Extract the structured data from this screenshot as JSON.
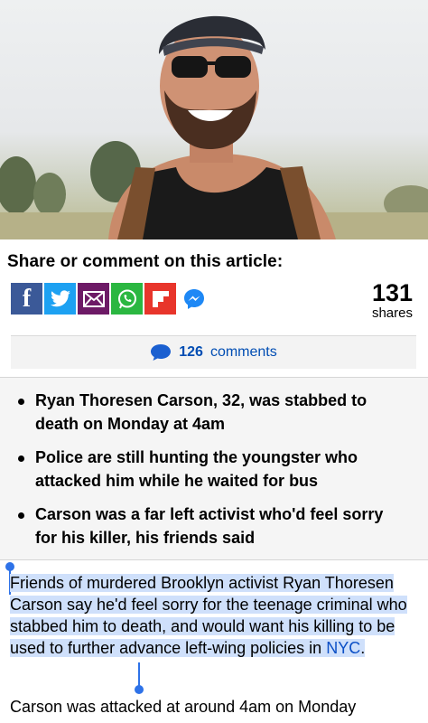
{
  "share": {
    "title": "Share or comment on this article:",
    "icons": [
      "facebook-icon",
      "twitter-icon",
      "email-icon",
      "whatsapp-icon",
      "flipboard-icon",
      "messenger-icon"
    ],
    "count": "131",
    "count_label": "shares"
  },
  "comments": {
    "count": "126",
    "label": "comments"
  },
  "bullets": [
    "Ryan Thoresen Carson, 32, was stabbed to death on Monday at 4am",
    "Police are still hunting the youngster who attacked him while he waited for bus",
    "Carson was a far left activist who'd feel sorry for his killer, his friends said"
  ],
  "article": {
    "para1_text": "Friends of murdered Brooklyn activist Ryan Thoresen Carson say he'd feel sorry for the teenage criminal who stabbed him to death, and would want his killing to be used to further advance left-wing policies in ",
    "para1_link": "NYC",
    "para1_end": ".",
    "para2_text": "Carson was attacked at around 4am on Monday"
  },
  "colors": {
    "facebook": "#3b5998",
    "twitter": "#1da1f2",
    "email": "#6d1a66",
    "whatsapp": "#2bb741",
    "flipboard": "#e8352b",
    "link": "#0b4fc6",
    "selection": "#cfe0fb"
  }
}
